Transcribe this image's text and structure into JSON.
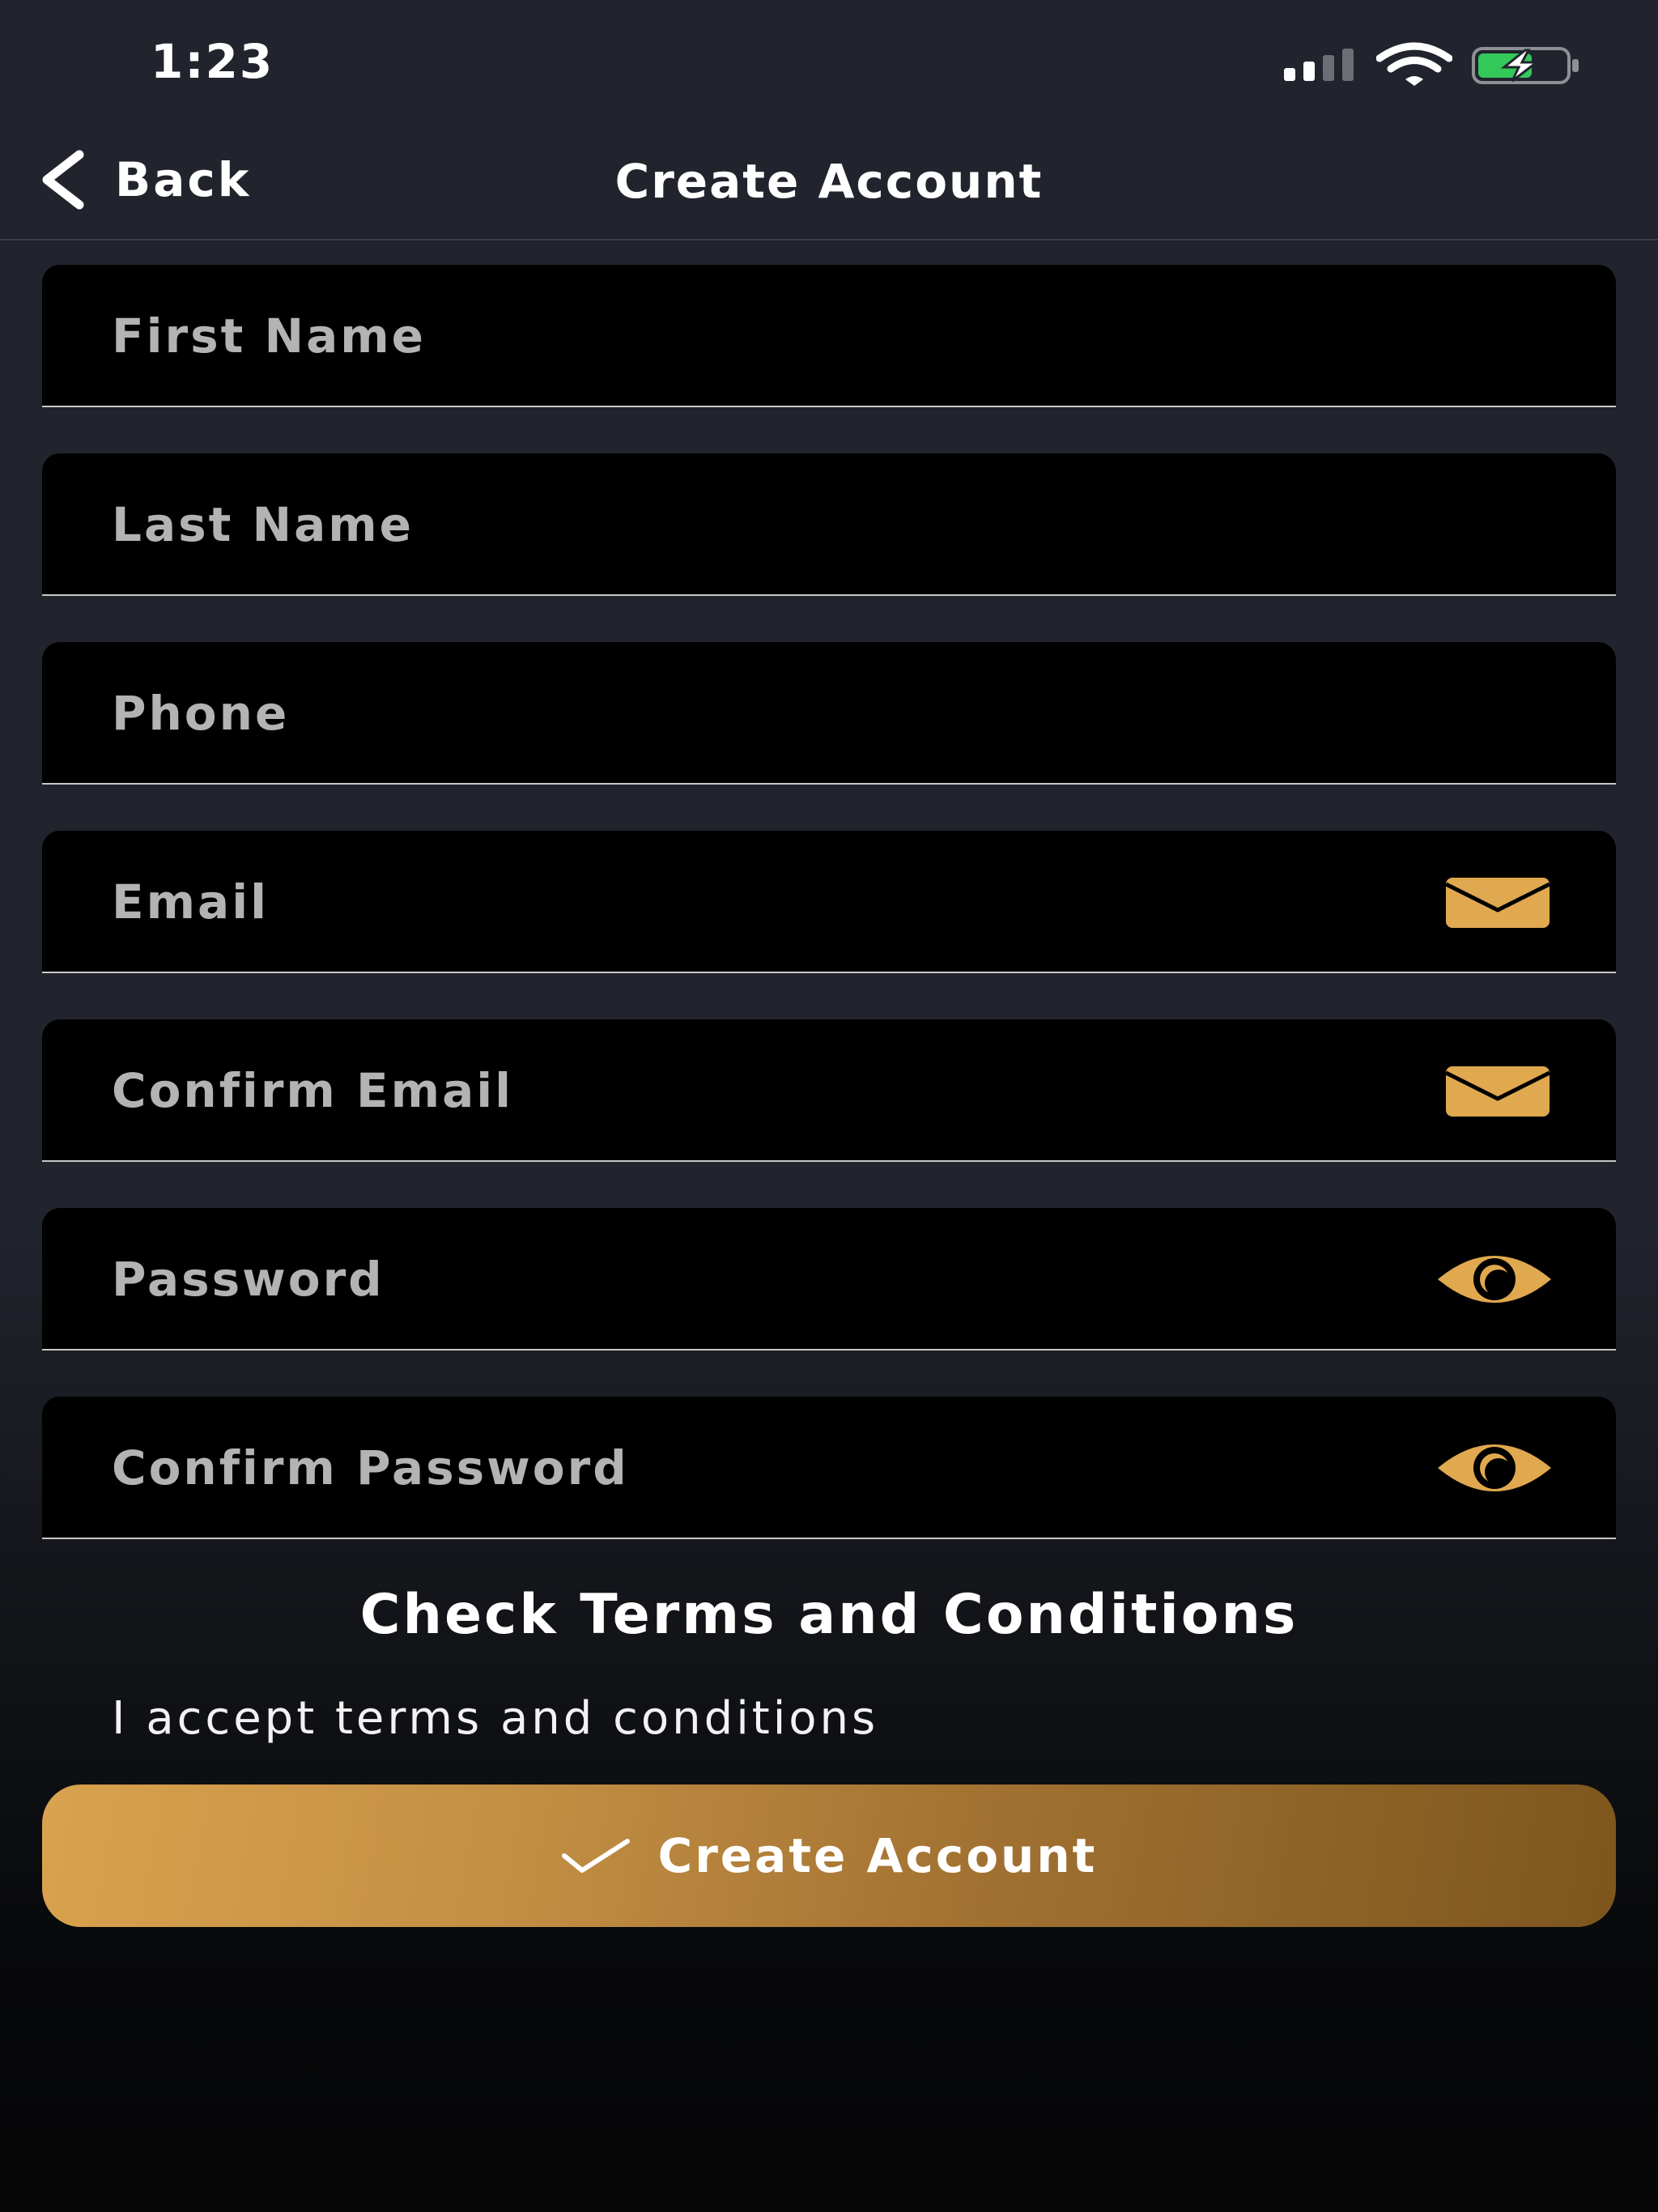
{
  "status_bar": {
    "time": "1:23",
    "icons": [
      "cellular-signal-icon",
      "wifi-icon",
      "battery-charging-icon"
    ]
  },
  "nav": {
    "back_label": "Back",
    "title": "Create Account"
  },
  "form": {
    "fields": [
      {
        "placeholder": "First Name",
        "value": "",
        "icon": null
      },
      {
        "placeholder": "Last Name",
        "value": "",
        "icon": null
      },
      {
        "placeholder": "Phone",
        "value": "",
        "icon": null
      },
      {
        "placeholder": "Email",
        "value": "",
        "icon": "envelope-icon"
      },
      {
        "placeholder": "Confirm Email",
        "value": "",
        "icon": "envelope-icon"
      },
      {
        "placeholder": "Password",
        "value": "",
        "icon": "eye-icon"
      },
      {
        "placeholder": "Confirm Password",
        "value": "",
        "icon": "eye-icon"
      }
    ]
  },
  "terms": {
    "heading": "Check Terms and Conditions",
    "accept_label": "I accept terms and conditions"
  },
  "submit": {
    "label": "Create Account",
    "icon": "checkmark-icon"
  },
  "colors": {
    "background": "#21242d",
    "field_background": "#000000",
    "accent": "#e0a84f",
    "placeholder": "#b3b3b3",
    "button_gradient_start": "#d8a24e",
    "button_gradient_end": "#7d561e",
    "battery_fill": "#34c759"
  }
}
